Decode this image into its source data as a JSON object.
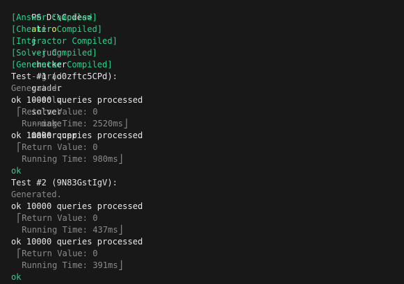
{
  "prompt": {
    "ps": "PS D:\\Codes>",
    "command": "atiro",
    "args": [
      {
        "text": "j",
        "kind": "white"
      },
      {
        "text": "--judg",
        "kind": "gray"
      },
      {
        "text": "checker",
        "kind": "white"
      },
      {
        "text": "--grad",
        "kind": "gray"
      },
      {
        "text": "grader",
        "kind": "white"
      },
      {
        "text": "--solv",
        "kind": "gray"
      },
      {
        "text": "solver",
        "kind": "white"
      },
      {
        "text": "--make",
        "kind": "gray"
      },
      {
        "text": "maker.cpp",
        "kind": "white"
      }
    ]
  },
  "compiled": [
    "[Answer Compiled]",
    "[Checker Compiled]",
    "[Interactor Compiled]",
    "[Solver Compiled]",
    "[Generator Compiled]"
  ],
  "tests": [
    {
      "header": "Test #1 (o0zftc5CPd):",
      "generated": "Generated.",
      "runs": [
        {
          "result": "ok 10000 queries processed",
          "return_value": "⎡Return Value: 0",
          "running_time": " Running Time: 2520ms⎦"
        },
        {
          "result": "ok 10000 queries processed",
          "return_value": "⎡Return Value: 0",
          "running_time": " Running Time: 980ms⎦"
        }
      ],
      "verdict": "ok"
    },
    {
      "header": "Test #2 (9N83GstIgV):",
      "generated": "Generated.",
      "runs": [
        {
          "result": "ok 10000 queries processed",
          "return_value": "⎡Return Value: 0",
          "running_time": " Running Time: 437ms⎦"
        },
        {
          "result": "ok 10000 queries processed",
          "return_value": "⎡Return Value: 0",
          "running_time": " Running Time: 391ms⎦"
        }
      ],
      "verdict": "ok"
    }
  ],
  "colors": {
    "background": "#181818",
    "compiled_green": "#23d18b",
    "command_yellow": "#f5f543",
    "flag_gray": "#a0a0a0",
    "text": "#cccccc"
  }
}
